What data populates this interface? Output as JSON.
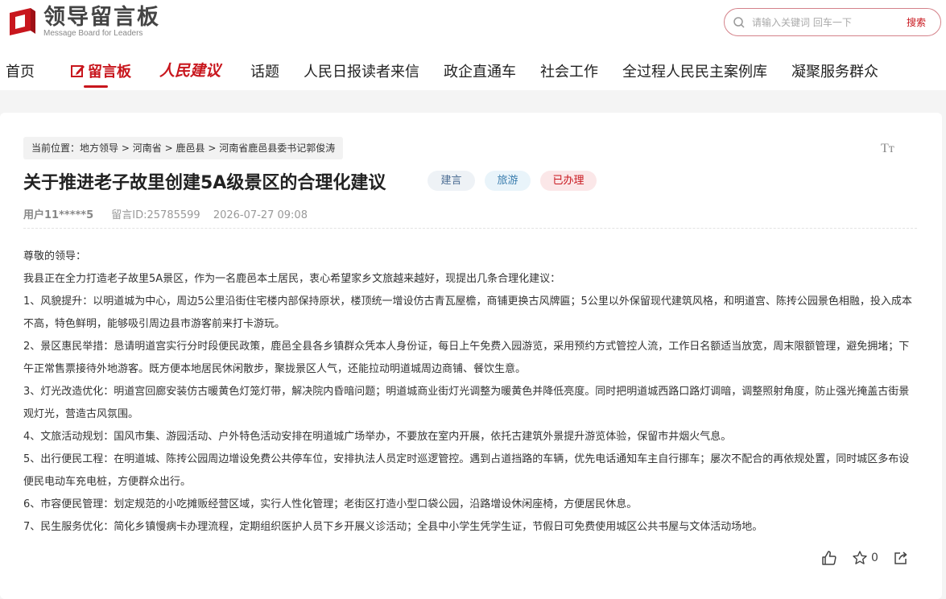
{
  "logo": {
    "title": "领导留言板",
    "subtitle": "Message Board for Leaders"
  },
  "search": {
    "placeholder": "请输入关键词 回车一下",
    "button": "搜索"
  },
  "nav": {
    "home": "首页",
    "message_board": "留言板",
    "rmjy": "人民建议",
    "topics": "话题",
    "reader_letters": "人民日报读者来信",
    "gov_biz": "政企直通车",
    "social_work": "社会工作",
    "democracy_cases": "全过程人民民主案例库",
    "gather_service": "凝聚服务群众"
  },
  "breadcrumb": {
    "prefix": "当前位置：",
    "items": [
      "地方领导",
      "河南省",
      "鹿邑县",
      "河南省鹿邑县委书记郭俊涛"
    ],
    "sep": ">"
  },
  "font_size_icon": "Tт",
  "post": {
    "title": "关于推进老子故里创建5A级景区的合理化建议",
    "tags": [
      "建言",
      "旅游",
      "已办理"
    ],
    "user": "用户11*****5",
    "message_id": "留言ID:25785599",
    "datetime": "2026-07-27 09:08",
    "paragraphs": [
      "尊敬的领导：",
      "我县正在全力打造老子故里5A景区，作为一名鹿邑本土居民，衷心希望家乡文旅越来越好，现提出几条合理化建议：",
      "1、风貌提升：以明道城为中心，周边5公里沿街住宅楼内部保持原状，楼顶统一增设仿古青瓦屋檐，商铺更换古风牌匾；5公里以外保留现代建筑风格，和明道宫、陈抟公园景色相融，投入成本不高，特色鲜明，能够吸引周边县市游客前来打卡游玩。",
      "2、景区惠民举措：恳请明道宫实行分时段便民政策，鹿邑全县各乡镇群众凭本人身份证，每日上午免费入园游览，采用预约方式管控人流，工作日名额适当放宽，周末限额管理，避免拥堵；下午正常售票接待外地游客。既方便本地居民休闲散步，聚拢景区人气，还能拉动明道城周边商铺、餐饮生意。",
      "3、灯光改造优化：明道宫回廊安装仿古暖黄色灯笼灯带，解决院内昏暗问题；明道城商业街灯光调整为暖黄色并降低亮度。同时把明道城西路口路灯调暗，调整照射角度，防止强光掩盖古街景观灯光，营造古风氛围。",
      "4、文旅活动规划：国风市集、游园活动、户外特色活动安排在明道城广场举办，不要放在室内开展，依托古建筑外景提升游览体验，保留市井烟火气息。",
      "5、出行便民工程：在明道城、陈抟公园周边增设免费公共停车位，安排执法人员定时巡逻管控。遇到占道挡路的车辆，优先电话通知车主自行挪车；屡次不配合的再依规处置，同时城区多布设便民电动车充电桩，方便群众出行。",
      "6、市容便民管理：划定规范的小吃摊贩经营区域，实行人性化管理；老街区打造小型口袋公园，沿路增设休闲座椅，方便居民休息。",
      "7、民生服务优化：简化乡镇慢病卡办理流程，定期组织医护人员下乡开展义诊活动；全县中小学生凭学生证，节假日可免费使用城区公共书屋与文体活动场地。"
    ],
    "star_count": "0"
  },
  "colors": {
    "accent": "#c8161d",
    "tag_jy": "#4d6e94",
    "tag_ly": "#3a7dae",
    "tag_done": "#c8161d"
  }
}
